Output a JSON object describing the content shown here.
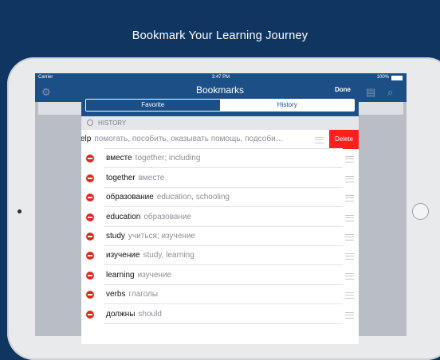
{
  "headline": "Bookmark Your Learning Journey",
  "status": {
    "carrier": "Carrier",
    "wifi": "wifi-icon",
    "time": "3:47 PM",
    "battery": "100%"
  },
  "sheet": {
    "title": "Bookmarks",
    "done": "Done",
    "tabs": [
      {
        "label": "Favorite",
        "active": true
      },
      {
        "label": "History",
        "active": false
      }
    ],
    "section": "HISTORY",
    "delete_label": "Delete",
    "rows": [
      {
        "word": "elp",
        "translation": "помогать, пособить, оказывать помощь, подсоби…",
        "swiped": true
      },
      {
        "word": "вместе",
        "translation": "together; including"
      },
      {
        "word": "together",
        "translation": "вместе"
      },
      {
        "word": "образование",
        "translation": "education, schooling"
      },
      {
        "word": "education",
        "translation": "образование"
      },
      {
        "word": "study",
        "translation": "учиться; изучение"
      },
      {
        "word": "изучение",
        "translation": "study, learning"
      },
      {
        "word": "learning",
        "translation": "изучение"
      },
      {
        "word": "verbs",
        "translation": "глаголы"
      },
      {
        "word": "должны",
        "translation": "should"
      }
    ]
  },
  "colors": {
    "accent": "#1c4f86",
    "background": "#0f3561",
    "delete": "#ff1f1f",
    "remove": "#e1251b"
  }
}
